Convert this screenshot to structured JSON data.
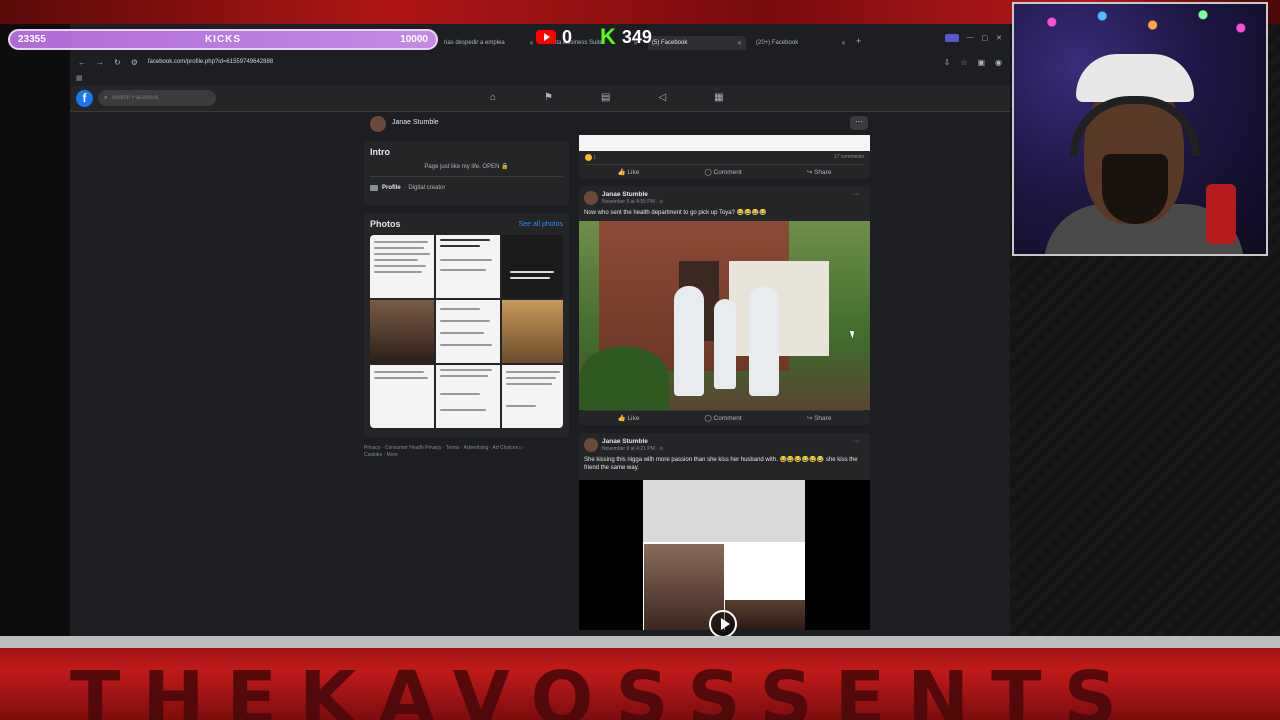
{
  "stream_overlay": {
    "goal_current": "23355",
    "goal_title": "KICKS",
    "goal_target": "10000",
    "goal_progress": 1.0,
    "youtube_count": "0",
    "kick_count": "349",
    "brand_text": "THEKAVOSSSENTS"
  },
  "browser": {
    "tabs": [
      {
        "label": "rias despedir a emplea",
        "active": false
      },
      {
        "label": "Meta Business Suite",
        "active": false
      },
      {
        "label": "(5) Facebook",
        "active": true
      },
      {
        "label": "(20+) Facebook",
        "active": false
      }
    ],
    "url": "facebook.com/profile.php?id=61559749642888"
  },
  "facebook": {
    "search_placeholder": "Search Facebook",
    "nav_icons": [
      "home-icon",
      "flag-icon",
      "marketplace-icon",
      "megaphone-icon",
      "calendar-icon"
    ],
    "profile_name": "Janae Stumble",
    "more_label": "···",
    "intro": {
      "title": "Intro",
      "bio": "Page just like my life, OPEN 🔒",
      "category_bold": "Profile",
      "category_rest": " · Digital creator"
    },
    "photos": {
      "title": "Photos",
      "see_all": "See all photos"
    },
    "footer_line1": "Privacy · Consumer Health Privacy · Terms · Advertising · Ad Choices ▷",
    "footer_line2": "Cookies · More",
    "posts": [
      {
        "reaction_count": "1",
        "comments": "17 comments",
        "like": "Like",
        "comment": "Comment",
        "share": "Share"
      },
      {
        "author": "Janae Stumble",
        "time": "November 9 at 4:55 PM · ⊙",
        "text": "Now who sent the health department to go pick up Toya? 😂😂😂😂",
        "like": "Like",
        "comment": "Comment",
        "share": "Share"
      },
      {
        "author": "Janae Stumble",
        "time": "November 9 at 4:21 PM · ⊙",
        "text": "She kissing this nigga with more passion than she kiss her husband with. 😂😂😂😂😂😂 she kiss the friend the same way."
      }
    ]
  }
}
